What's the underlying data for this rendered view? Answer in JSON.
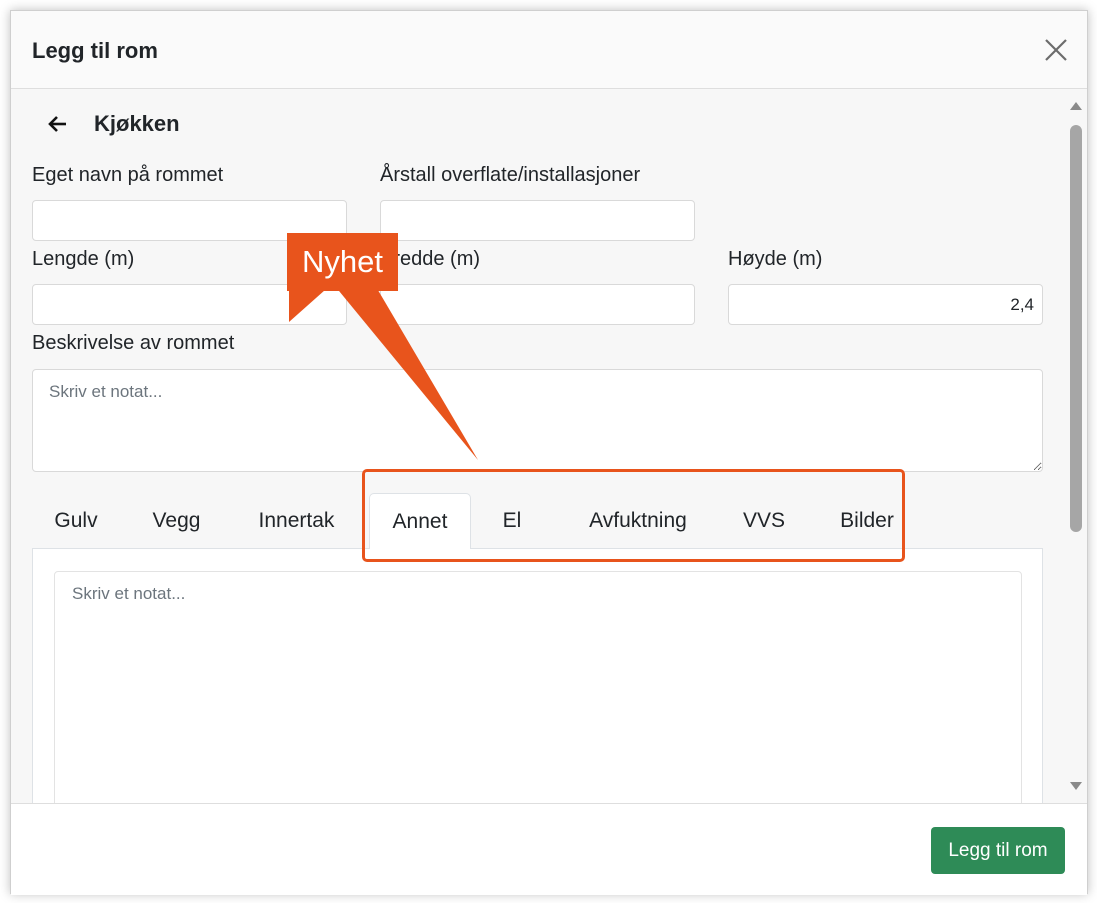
{
  "dialog": {
    "title": "Legg til rom",
    "close_icon": "close-icon"
  },
  "room": {
    "back_icon": "arrow-left-icon",
    "name": "Kjøkken"
  },
  "form": {
    "custom_name": {
      "label": "Eget navn på rommet",
      "value": ""
    },
    "year": {
      "label": "Årstall overflate/installasjoner",
      "value": ""
    },
    "length": {
      "label": "Lengde (m)",
      "value": ""
    },
    "width": {
      "label": "Bredde (m)",
      "value": ""
    },
    "height": {
      "label": "Høyde (m)",
      "value": "2,4"
    },
    "description": {
      "label": "Beskrivelse av rommet",
      "placeholder": "Skriv et notat..."
    }
  },
  "tabs": [
    {
      "label": "Gulv",
      "active": false
    },
    {
      "label": "Vegg",
      "active": false
    },
    {
      "label": "Innertak",
      "active": false
    },
    {
      "label": "Annet",
      "active": true
    },
    {
      "label": "El",
      "active": false
    },
    {
      "label": "Avfuktning",
      "active": false
    },
    {
      "label": "VVS",
      "active": false
    },
    {
      "label": "Bilder",
      "active": false
    }
  ],
  "tab_content": {
    "note_placeholder": "Skriv et notat..."
  },
  "footer": {
    "submit_label": "Legg til rom"
  },
  "annotation": {
    "label": "Nyhet",
    "color": "#e8541c"
  },
  "colors": {
    "primary_button": "#2e8b57",
    "annotation": "#e8541c"
  }
}
